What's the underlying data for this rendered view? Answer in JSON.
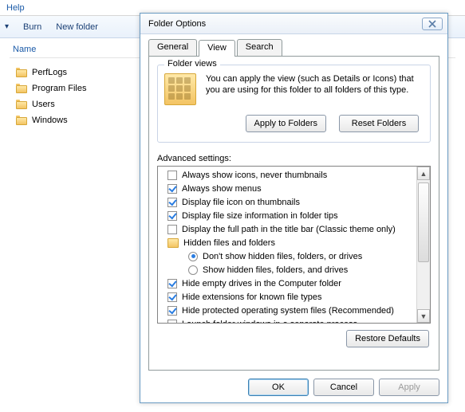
{
  "menubar": {
    "help": "Help"
  },
  "toolbar": {
    "burn": "Burn",
    "newfolder": "New folder"
  },
  "column": {
    "name": "Name"
  },
  "tree": [
    {
      "label": "PerfLogs"
    },
    {
      "label": "Program Files"
    },
    {
      "label": "Users"
    },
    {
      "label": "Windows"
    }
  ],
  "dialog": {
    "title": "Folder Options",
    "tabs": {
      "general": "General",
      "view": "View",
      "search": "Search"
    },
    "folderviews": {
      "legend": "Folder views",
      "text": "You can apply the view (such as Details or Icons) that you are using for this folder to all folders of this type.",
      "apply": "Apply to Folders",
      "reset": "Reset Folders"
    },
    "advanced": {
      "label": "Advanced settings:",
      "items": [
        {
          "type": "cb",
          "checked": false,
          "label": "Always show icons, never thumbnails"
        },
        {
          "type": "cb",
          "checked": true,
          "label": "Always show menus"
        },
        {
          "type": "cb",
          "checked": true,
          "label": "Display file icon on thumbnails"
        },
        {
          "type": "cb",
          "checked": true,
          "label": "Display file size information in folder tips"
        },
        {
          "type": "cb",
          "checked": false,
          "label": "Display the full path in the title bar (Classic theme only)"
        },
        {
          "type": "folder",
          "label": "Hidden files and folders"
        },
        {
          "type": "rb",
          "checked": true,
          "label": "Don't show hidden files, folders, or drives"
        },
        {
          "type": "rb",
          "checked": false,
          "label": "Show hidden files, folders, and drives"
        },
        {
          "type": "cb",
          "checked": true,
          "label": "Hide empty drives in the Computer folder"
        },
        {
          "type": "cb",
          "checked": true,
          "label": "Hide extensions for known file types"
        },
        {
          "type": "cb",
          "checked": true,
          "label": "Hide protected operating system files (Recommended)"
        },
        {
          "type": "cb",
          "checked": false,
          "label": "Launch folder windows in a separate process"
        }
      ],
      "restore": "Restore Defaults"
    },
    "buttons": {
      "ok": "OK",
      "cancel": "Cancel",
      "apply": "Apply"
    }
  }
}
